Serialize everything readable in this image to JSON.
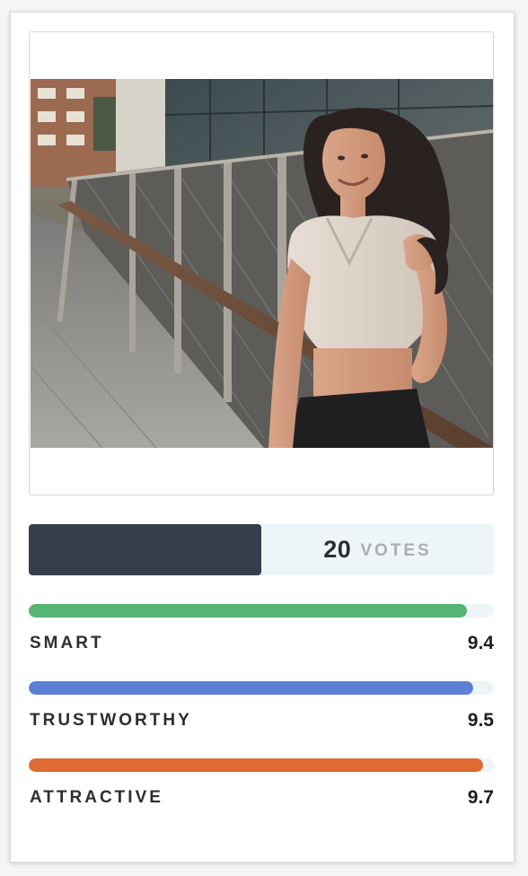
{
  "votes": {
    "count": "20",
    "label": "VOTES",
    "fill_fraction": 0.5,
    "fill_color": "#383d4c"
  },
  "traits": [
    {
      "name": "SMART",
      "score": "9.4",
      "fill_fraction": 0.943,
      "color": "#55b572"
    },
    {
      "name": "TRUSTWORTHY",
      "score": "9.5",
      "fill_fraction": 0.955,
      "color": "#5d7fd4"
    },
    {
      "name": "ATTRACTIVE",
      "score": "9.7",
      "fill_fraction": 0.977,
      "color": "#e06a34"
    }
  ]
}
